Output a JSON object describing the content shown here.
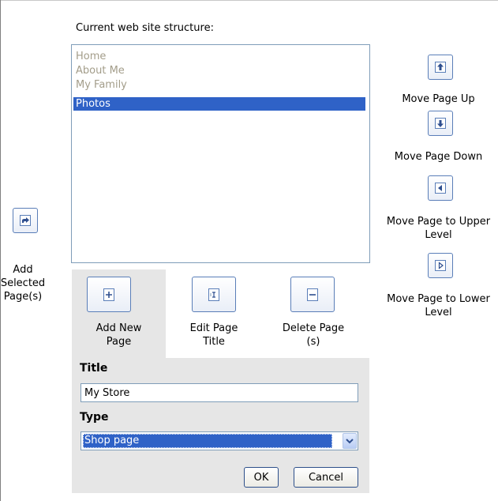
{
  "structure_label": "Current web site structure:",
  "pages": [
    {
      "label": "Home",
      "state": "disabled"
    },
    {
      "label": "About Me",
      "state": "disabled"
    },
    {
      "label": "My Family",
      "state": "disabled"
    },
    {
      "label": "Photos",
      "state": "selected"
    }
  ],
  "left_action": {
    "label": "Add Selected Page(s)",
    "lines": [
      "Add",
      "Selected",
      "Page(s)"
    ],
    "icon": "add-selected-icon"
  },
  "right_actions": [
    {
      "label": "Move Page Up",
      "lines": [
        "Move Page Up"
      ],
      "icon": "arrow-up-icon"
    },
    {
      "label": "Move Page Down",
      "lines": [
        "Move Page Down"
      ],
      "icon": "arrow-down-icon"
    },
    {
      "label": "Move Page to Upper Level",
      "lines": [
        "Move Page to Upper",
        "Level"
      ],
      "icon": "arrow-left-icon"
    },
    {
      "label": "Move Page to Lower Level",
      "lines": [
        "Move Page to Lower",
        "Level"
      ],
      "icon": "arrow-right-icon"
    }
  ],
  "tabs": [
    {
      "label": "Add New Page",
      "lines": [
        "Add New",
        "Page"
      ],
      "icon": "add-page-icon",
      "selected": true
    },
    {
      "label": "Edit Page Title",
      "lines": [
        "Edit Page",
        "Title"
      ],
      "icon": "edit-title-icon",
      "selected": false
    },
    {
      "label": "Delete Page (s)",
      "lines": [
        "Delete Page",
        "(s)"
      ],
      "icon": "delete-page-icon",
      "selected": false
    }
  ],
  "form": {
    "title_label": "Title",
    "title_value": "My Store",
    "type_label": "Type",
    "type_value": "Shop page",
    "ok_label": "OK",
    "cancel_label": "Cancel"
  },
  "colors": {
    "selection": "#2f62c7",
    "panel": "#e6e6e6",
    "disabled_text": "#a39d8a",
    "icon_border": "#5a7eb8"
  }
}
